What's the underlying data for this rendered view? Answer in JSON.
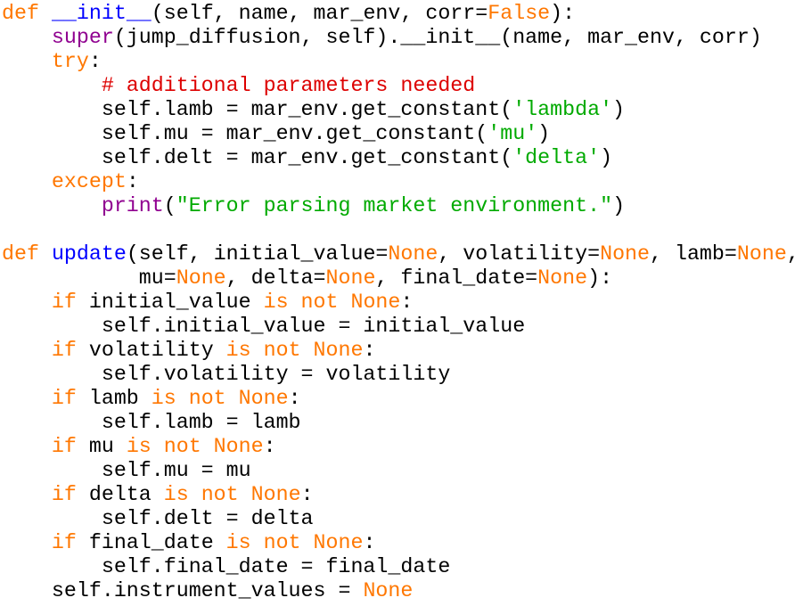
{
  "code": {
    "language": "python",
    "colors": {
      "keyword": "#ff7700",
      "function_name": "#0000ff",
      "builtin": "#900090",
      "string": "#00aa00",
      "comment": "#dd0000",
      "plain": "#000000"
    },
    "lines": [
      [
        {
          "t": "kw",
          "v": "def"
        },
        {
          "t": "pl",
          "v": " "
        },
        {
          "t": "fn",
          "v": "__init__"
        },
        {
          "t": "pl",
          "v": "(self, name, mar_env, corr="
        },
        {
          "t": "kw",
          "v": "False"
        },
        {
          "t": "pl",
          "v": "):"
        }
      ],
      [
        {
          "t": "pl",
          "v": "    "
        },
        {
          "t": "bi",
          "v": "super"
        },
        {
          "t": "pl",
          "v": "(jump_diffusion, self).__init__(name, mar_env, corr)"
        }
      ],
      [
        {
          "t": "pl",
          "v": "    "
        },
        {
          "t": "kw",
          "v": "try"
        },
        {
          "t": "pl",
          "v": ":"
        }
      ],
      [
        {
          "t": "pl",
          "v": "        "
        },
        {
          "t": "cm",
          "v": "# additional parameters needed"
        }
      ],
      [
        {
          "t": "pl",
          "v": "        self.lamb = mar_env.get_constant("
        },
        {
          "t": "str",
          "v": "'lambda'"
        },
        {
          "t": "pl",
          "v": ")"
        }
      ],
      [
        {
          "t": "pl",
          "v": "        self.mu = mar_env.get_constant("
        },
        {
          "t": "str",
          "v": "'mu'"
        },
        {
          "t": "pl",
          "v": ")"
        }
      ],
      [
        {
          "t": "pl",
          "v": "        self.delt = mar_env.get_constant("
        },
        {
          "t": "str",
          "v": "'delta'"
        },
        {
          "t": "pl",
          "v": ")"
        }
      ],
      [
        {
          "t": "pl",
          "v": "    "
        },
        {
          "t": "kw",
          "v": "except"
        },
        {
          "t": "pl",
          "v": ":"
        }
      ],
      [
        {
          "t": "pl",
          "v": "        "
        },
        {
          "t": "bi",
          "v": "print"
        },
        {
          "t": "pl",
          "v": "("
        },
        {
          "t": "str",
          "v": "\"Error parsing market environment.\""
        },
        {
          "t": "pl",
          "v": ")"
        }
      ],
      [],
      [
        {
          "t": "kw",
          "v": "def"
        },
        {
          "t": "pl",
          "v": " "
        },
        {
          "t": "fn",
          "v": "update"
        },
        {
          "t": "pl",
          "v": "(self, initial_value="
        },
        {
          "t": "kw",
          "v": "None"
        },
        {
          "t": "pl",
          "v": ", volatility="
        },
        {
          "t": "kw",
          "v": "None"
        },
        {
          "t": "pl",
          "v": ", lamb="
        },
        {
          "t": "kw",
          "v": "None"
        },
        {
          "t": "pl",
          "v": ","
        }
      ],
      [
        {
          "t": "pl",
          "v": "           mu="
        },
        {
          "t": "kw",
          "v": "None"
        },
        {
          "t": "pl",
          "v": ", delta="
        },
        {
          "t": "kw",
          "v": "None"
        },
        {
          "t": "pl",
          "v": ", final_date="
        },
        {
          "t": "kw",
          "v": "None"
        },
        {
          "t": "pl",
          "v": "):"
        }
      ],
      [
        {
          "t": "pl",
          "v": "    "
        },
        {
          "t": "kw",
          "v": "if"
        },
        {
          "t": "pl",
          "v": " initial_value "
        },
        {
          "t": "kw",
          "v": "is not None"
        },
        {
          "t": "pl",
          "v": ":"
        }
      ],
      [
        {
          "t": "pl",
          "v": "        self.initial_value = initial_value"
        }
      ],
      [
        {
          "t": "pl",
          "v": "    "
        },
        {
          "t": "kw",
          "v": "if"
        },
        {
          "t": "pl",
          "v": " volatility "
        },
        {
          "t": "kw",
          "v": "is not None"
        },
        {
          "t": "pl",
          "v": ":"
        }
      ],
      [
        {
          "t": "pl",
          "v": "        self.volatility = volatility"
        }
      ],
      [
        {
          "t": "pl",
          "v": "    "
        },
        {
          "t": "kw",
          "v": "if"
        },
        {
          "t": "pl",
          "v": " lamb "
        },
        {
          "t": "kw",
          "v": "is not None"
        },
        {
          "t": "pl",
          "v": ":"
        }
      ],
      [
        {
          "t": "pl",
          "v": "        self.lamb = lamb"
        }
      ],
      [
        {
          "t": "pl",
          "v": "    "
        },
        {
          "t": "kw",
          "v": "if"
        },
        {
          "t": "pl",
          "v": " mu "
        },
        {
          "t": "kw",
          "v": "is not None"
        },
        {
          "t": "pl",
          "v": ":"
        }
      ],
      [
        {
          "t": "pl",
          "v": "        self.mu = mu"
        }
      ],
      [
        {
          "t": "pl",
          "v": "    "
        },
        {
          "t": "kw",
          "v": "if"
        },
        {
          "t": "pl",
          "v": " delta "
        },
        {
          "t": "kw",
          "v": "is not None"
        },
        {
          "t": "pl",
          "v": ":"
        }
      ],
      [
        {
          "t": "pl",
          "v": "        self.delt = delta"
        }
      ],
      [
        {
          "t": "pl",
          "v": "    "
        },
        {
          "t": "kw",
          "v": "if"
        },
        {
          "t": "pl",
          "v": " final_date "
        },
        {
          "t": "kw",
          "v": "is not None"
        },
        {
          "t": "pl",
          "v": ":"
        }
      ],
      [
        {
          "t": "pl",
          "v": "        self.final_date = final_date"
        }
      ],
      [
        {
          "t": "pl",
          "v": "    self.instrument_values = "
        },
        {
          "t": "kw",
          "v": "None"
        }
      ]
    ]
  }
}
